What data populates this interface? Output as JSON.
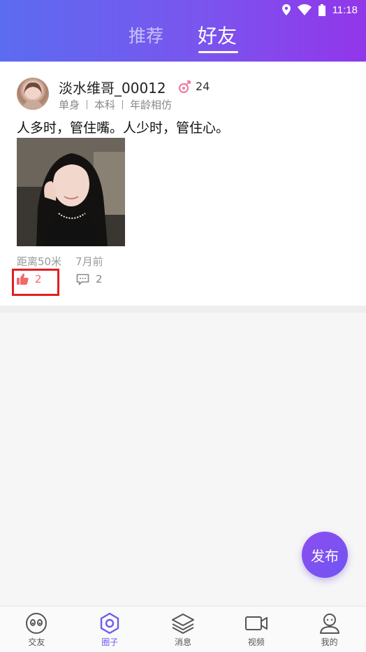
{
  "status_bar": {
    "time": "11:18"
  },
  "tabs": [
    {
      "label": "推荐",
      "active": false
    },
    {
      "label": "好友",
      "active": true
    }
  ],
  "post": {
    "username": "淡水维哥_00012",
    "age": "24",
    "tags": [
      "单身",
      "本科",
      "年龄相仿"
    ],
    "text": "人多时，管住嘴。人少时，管住心。",
    "distance": "距离50米",
    "time": "7月前",
    "likes": "2",
    "comments": "2"
  },
  "fab": {
    "label": "发布"
  },
  "bottom_nav": [
    {
      "label": "交友",
      "icon": "face-icon"
    },
    {
      "label": "圈子",
      "icon": "hexagon-icon",
      "active": true
    },
    {
      "label": "消息",
      "icon": "layers-icon"
    },
    {
      "label": "视频",
      "icon": "video-icon"
    },
    {
      "label": "我的",
      "icon": "person-icon"
    }
  ],
  "colors": {
    "header_gradient_start": "#5b6cf0",
    "header_gradient_end": "#9236ea",
    "like": "#f06a6a",
    "highlight_box": "#e02020",
    "nav_active": "#6a5cf0"
  }
}
